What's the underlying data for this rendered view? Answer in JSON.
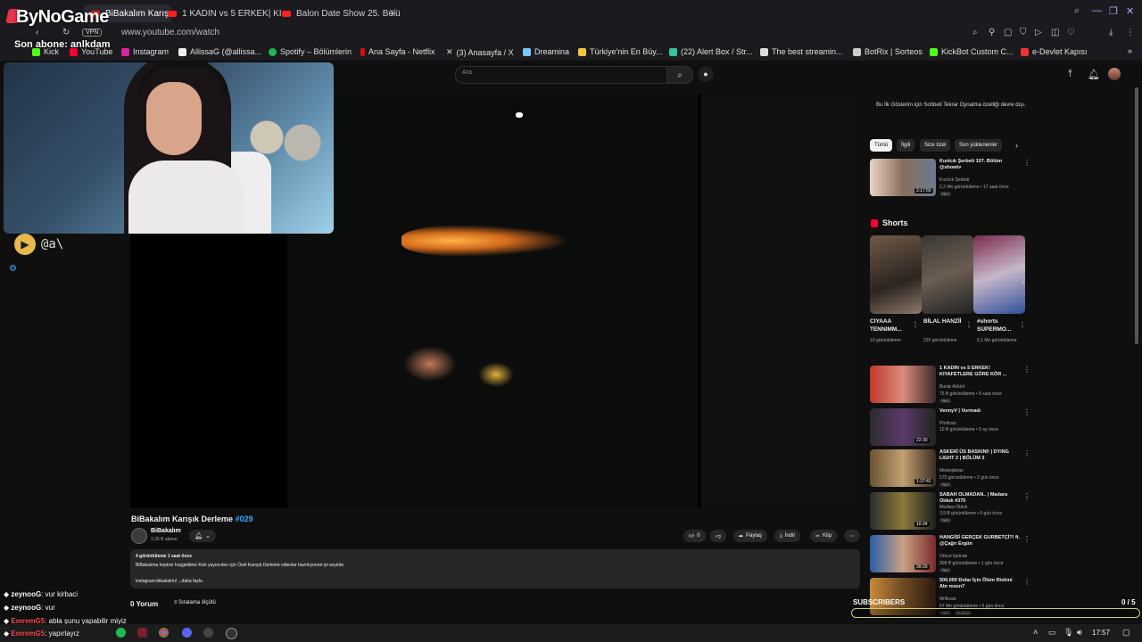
{
  "browser": {
    "tabs": [
      {
        "label": "BiBakalım Karışık Derleme",
        "active": true
      },
      {
        "label": "1 KADIN vs 5 ERKEK| KIY"
      },
      {
        "label": "Balon Date Show 25. Bölü"
      }
    ],
    "new_tab": "+",
    "url": "www.youtube.com/watch",
    "vpn": "VPN",
    "bookmarks": [
      "Kick",
      "YouTube",
      "Instagram",
      "AllissaG (@allissa...",
      "Spotify – Bölümlerin",
      "Ana Sayfa - Netflix",
      "(3) Anasayfa / X",
      "Dreamina",
      "Türkiye'nin En Büy...",
      "(22) Alert Box / Str...",
      "The best streamin...",
      "BotRix | Sorteos",
      "KickBot Custom C...",
      "e-Devlet Kapısı"
    ]
  },
  "overlay": {
    "brand": "ByNoGame",
    "last_subscriber": "Son abone: anlkdam",
    "handle": "@a\\",
    "subs_goal_label": "SUBSCRIBERS",
    "subs_goal_count": "0 / 5",
    "subs_goal_progress": 0
  },
  "youtube": {
    "search_placeholder": "Ara",
    "video": {
      "title": "BiBakalım Karışık Derleme",
      "tag": "#029",
      "channel": "BiBakalım",
      "subscribers": "1,05 B abone",
      "likes": "0",
      "share": "Paylaş",
      "download": "İndir",
      "clip": "Klip",
      "desc_meta": "4 görüntüleme  1 saat önce",
      "desc_text": "BiBakalıma hepiniz hoşgeldiniz Kick yayıncıları için Özel Karışık Derleme videolar hazırlıyorum iyi seyirler.",
      "desc_link": "instagram:bibakalım/ ...daha fazla",
      "comments": "0 Yorum",
      "sort": "Sıralama ölçütü"
    },
    "chat_note": "Bu İlk Gösterim için Sohbeti Tekrar Oynatma özelliği devre dışı.",
    "chips": [
      "Tümü",
      "İlgili",
      "Size özel",
      "Son yüklenenler"
    ],
    "recs_top": [
      {
        "title": "Kızılcık Şerbeti 107. Bölüm @showtv",
        "channel": "Kızılcık Şerbeti",
        "meta": "2,2 Mn görüntüleme • 17 saat önce",
        "badge": "Yeni",
        "duration": "2:17:55"
      }
    ],
    "shorts_title": "Shorts",
    "shorts": [
      {
        "title": "CIYAAA TENNIMM...",
        "views": "10 görüntüleme"
      },
      {
        "title": "BİLAL HANZİİ",
        "views": "225 görüntüleme"
      },
      {
        "title": "#shorts SUPERMO...",
        "views": "5,1 Mn görüntüleme"
      }
    ],
    "recs": [
      {
        "title": "1 KADIN vs 5 ERKEK! KIYAFETLERE GÖRE KÖR ...",
        "channel": "Burak Aktürk",
        "meta": "75 B görüntüleme • 5 saat önce",
        "badge": "Yeni",
        "duration": ""
      },
      {
        "title": "VennyV | Vurmadı",
        "channel": "Phriksss",
        "meta": "10 B görüntüleme • 5 ay önce",
        "badge": "",
        "duration": "22:30"
      },
      {
        "title": "ASKERİ ÜS BASKINI! | DYING LIGHT 2 | BÖLÜM 3",
        "channel": "Melanijanas",
        "meta": "575 görüntüleme • 2 gün önce",
        "badge": "Yeni",
        "duration": "1:37:41"
      },
      {
        "title": "SABAH OLMADAN.. | Madara Olduk #375",
        "channel": "Madara Olduk",
        "meta": "3,9 B görüntüleme • 6 gün önce",
        "badge": "Yeni",
        "duration": "10:34"
      },
      {
        "title": "HANGİSİ GERÇEK GURBETÇİ?! ft. @Çağrı Ergün",
        "channel": "Orkun Işıtmak",
        "meta": "908 B görüntüleme • 1 gün önce",
        "badge": "Yeni",
        "duration": "39:20"
      },
      {
        "title": "500.000 Dolar İçin Ölüm Riskini Alır mısın?",
        "channel": "MrBeast",
        "meta": "67 Mn görüntüleme • 6 gün önce",
        "badge": "Yeni",
        "duration": "",
        "extra": "Dublajlı"
      }
    ]
  },
  "chat": [
    {
      "user": "zeynooG",
      "msg": ": vur kirbaci",
      "color": "#ffffff"
    },
    {
      "user": "zeynooG",
      "msg": ": vur",
      "color": "#ffffff"
    },
    {
      "user": "EmremG5",
      "msg": ": abla şunu yapabilir miyiz",
      "color": "#ff4d4d"
    },
    {
      "user": "EmremG5",
      "msg": ": yapırlayız",
      "color": "#ff4d4d"
    }
  ],
  "taskbar": {
    "time": "17:57"
  },
  "colors": {
    "accent": "#3ea6ff",
    "youtube_red": "#ff0033",
    "overlay_gold": "#e7b94c"
  }
}
